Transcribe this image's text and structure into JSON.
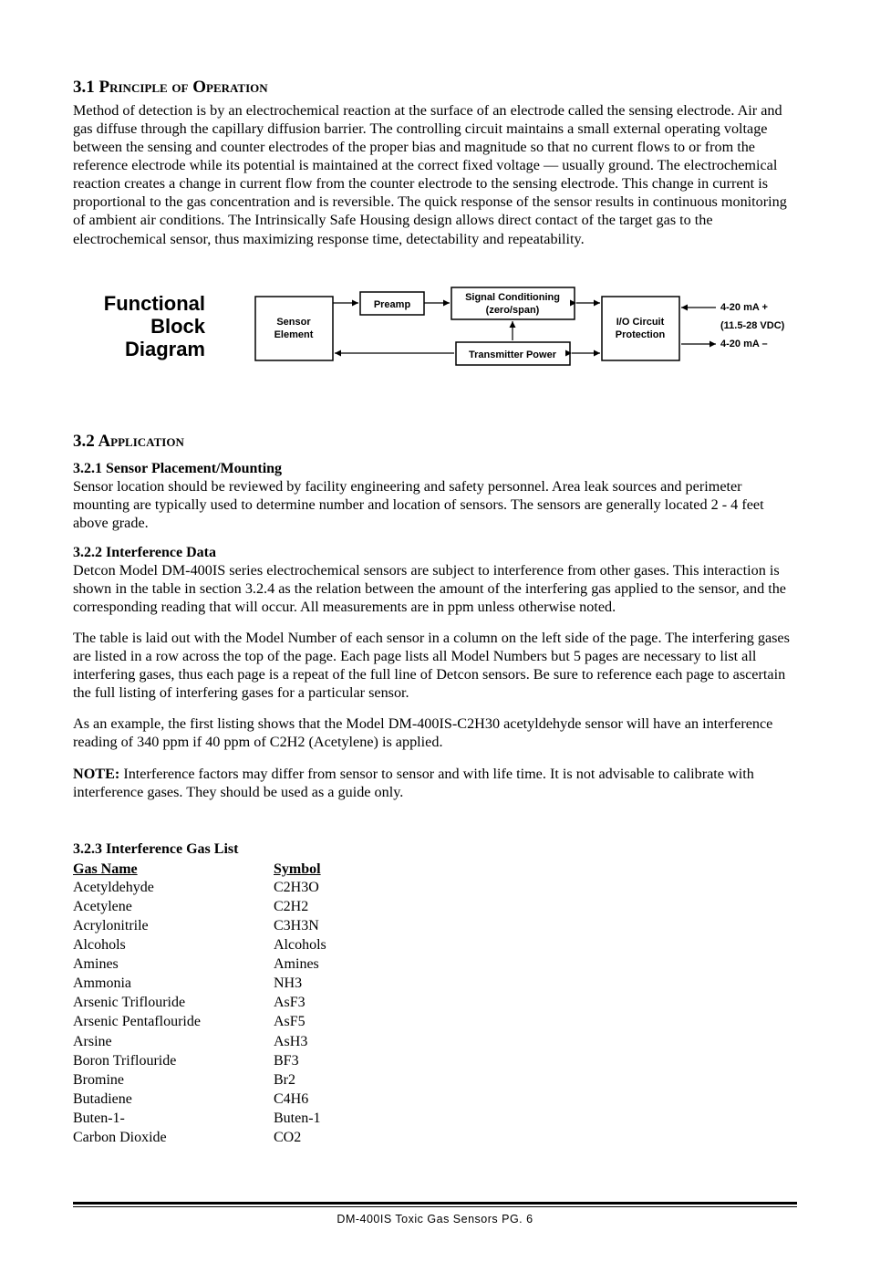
{
  "section31": {
    "heading_num": "3.1",
    "heading_text": "Principle of Operation",
    "body": "Method of detection is by an electrochemical reaction at the surface of an electrode called the sensing electrode. Air and gas diffuse through the capillary diffusion barrier. The controlling circuit maintains a small external operating voltage between the sensing and counter electrodes of the proper bias and magnitude so that no current flows to or from the reference electrode while its potential is maintained at the correct fixed voltage — usually ground. The electrochemical reaction creates a change in current flow from the counter electrode to the sensing electrode. This change in current is proportional to the gas concentration and is reversible. The quick response of the sensor results in continuous monitoring of ambient air conditions. The Intrinsically Safe Housing design allows direct contact of the target gas to the electrochemical sensor, thus maximizing response time, detectability and repeatability."
  },
  "diagram": {
    "title_line1": "Functional",
    "title_line2": "Block",
    "title_line3": "Diagram",
    "box_sensor": "Sensor Element",
    "box_preamp": "Preamp",
    "box_signal_line1": "Signal Conditioning",
    "box_signal_line2": "(zero/span)",
    "box_power": "Transmitter Power",
    "box_io_line1": "I/O Circuit",
    "box_io_line2": "Protection",
    "label_420_plus": "4-20 mA +",
    "label_vdc": "(11.5-28 VDC)",
    "label_420_minus": "4-20 mA –"
  },
  "section32": {
    "heading_num": "3.2",
    "heading_text": "Application",
    "s1_heading": "3.2.1  Sensor Placement/Mounting",
    "s1_body": "Sensor location should be reviewed by facility engineering and safety personnel. Area leak sources and perimeter mounting are typically used to determine number and location of sensors. The sensors are generally located 2 - 4 feet above grade.",
    "s2_heading": "3.2.2  Interference Data",
    "s2_body1": "Detcon Model DM-400IS series electrochemical sensors are subject to interference from other gases. This interaction is shown in the table in section 3.2.4 as the relation between the amount of the interfering gas applied to the sensor, and the corresponding reading that will occur. All measurements are in ppm unless otherwise noted.",
    "s2_body2": "The table is laid out with the Model Number of each sensor in a column on the left side of the page. The interfering gases are listed in a row across the top of the page. Each page lists all Model Numbers but 5 pages are necessary to list all interfering gases, thus each page is a repeat of the full line of Detcon sensors. Be sure to reference each page to ascertain the full listing of interfering gases for a particular sensor.",
    "s2_body3": "As an example, the first listing shows that the Model DM-400IS-C2H30 acetyldehyde sensor will have an interference reading of 340 ppm if 40 ppm of C2H2 (Acetylene) is applied.",
    "note_label": "NOTE:",
    "note_body": " Interference factors may differ from sensor to sensor and with life time. It is not advisable to calibrate with interference gases. They should be used as a guide only.",
    "s3_heading": "3.2.3  Interference Gas List",
    "table": {
      "col1_header": "Gas Name",
      "col2_header": "Symbol",
      "rows": [
        {
          "name": "Acetyldehyde",
          "sym": "C2H3O"
        },
        {
          "name": "Acetylene",
          "sym": "C2H2"
        },
        {
          "name": "Acrylonitrile",
          "sym": "C3H3N"
        },
        {
          "name": "Alcohols",
          "sym": "Alcohols"
        },
        {
          "name": "Amines",
          "sym": "Amines"
        },
        {
          "name": "Ammonia",
          "sym": "NH3"
        },
        {
          "name": "Arsenic Triflouride",
          "sym": "AsF3"
        },
        {
          "name": "Arsenic Pentaflouride",
          "sym": "AsF5"
        },
        {
          "name": "Arsine",
          "sym": "AsH3"
        },
        {
          "name": "Boron Triflouride",
          "sym": "BF3"
        },
        {
          "name": "Bromine",
          "sym": "Br2"
        },
        {
          "name": "Butadiene",
          "sym": "C4H6"
        },
        {
          "name": "Buten-1-",
          "sym": "Buten-1"
        },
        {
          "name": "Carbon Dioxide",
          "sym": "CO2"
        }
      ]
    }
  },
  "footer": "DM-400IS Toxic Gas Sensors   PG. 6"
}
